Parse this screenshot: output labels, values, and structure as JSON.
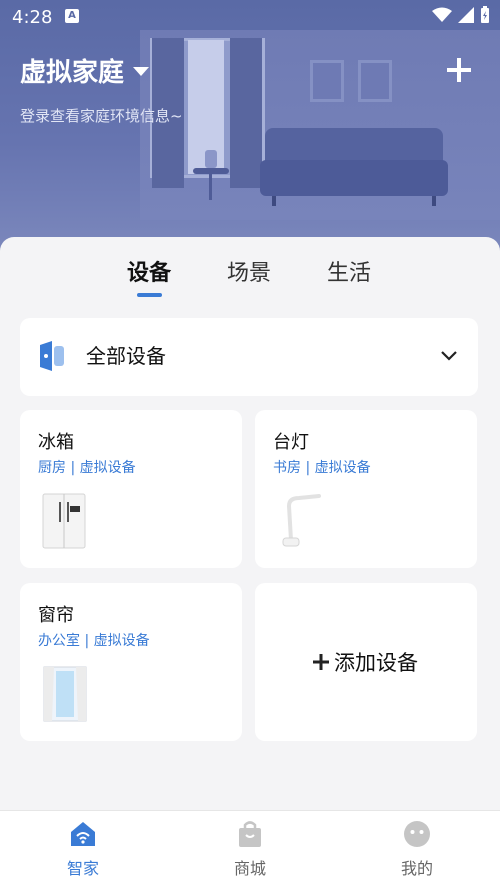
{
  "status": {
    "time": "4:28",
    "notif_badge": "A"
  },
  "header": {
    "home_name": "虚拟家庭",
    "subtitle": "登录查看家庭环境信息~"
  },
  "tabs": [
    {
      "label": "设备",
      "active": true
    },
    {
      "label": "场景",
      "active": false
    },
    {
      "label": "生活",
      "active": false
    }
  ],
  "all_devices": {
    "label": "全部设备"
  },
  "devices": [
    {
      "name": "冰箱",
      "location": "厨房 | 虚拟设备",
      "icon": "fridge-icon"
    },
    {
      "name": "台灯",
      "location": "书房 | 虚拟设备",
      "icon": "desk-lamp-icon"
    },
    {
      "name": "窗帘",
      "location": "办公室 | 虚拟设备",
      "icon": "curtain-icon"
    }
  ],
  "add_device": {
    "label": "添加设备"
  },
  "nav": [
    {
      "label": "智家",
      "icon": "smart-home-icon",
      "active": true
    },
    {
      "label": "商城",
      "icon": "shopping-bag-icon",
      "active": false
    },
    {
      "label": "我的",
      "icon": "profile-icon",
      "active": false
    }
  ],
  "colors": {
    "accent": "#3a7bd5",
    "hero": "#5a6aa6"
  }
}
